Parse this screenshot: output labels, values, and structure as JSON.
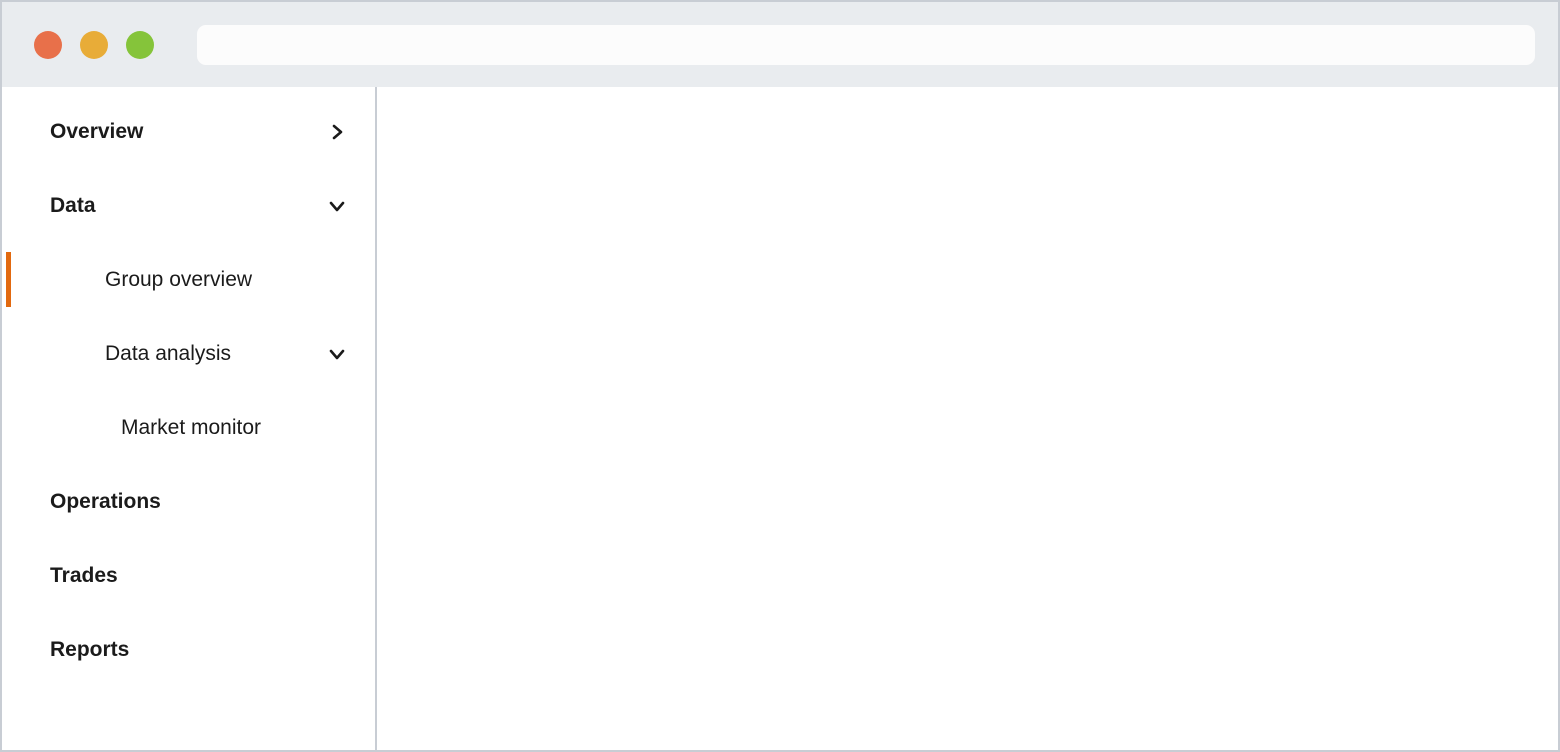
{
  "window": {
    "traffic_lights": [
      {
        "name": "close",
        "color": "#e8704a"
      },
      {
        "name": "minimize",
        "color": "#e8ac38"
      },
      {
        "name": "maximize",
        "color": "#85c43a"
      }
    ]
  },
  "address_bar": {
    "value": "",
    "placeholder": ""
  },
  "theme": {
    "chrome_background": "#e9ecef",
    "window_border": "#c8cdd4",
    "accent": "#e2690f",
    "text": "#1b1b1b",
    "panel_background": "#ffffff"
  },
  "sidebar": {
    "items": [
      {
        "label": "Overview",
        "level": 0,
        "chevron": "chevron-right-icon",
        "active": false
      },
      {
        "label": "Data",
        "level": 0,
        "chevron": "chevron-down-icon",
        "active": false
      },
      {
        "label": "Group overview",
        "level": 1,
        "chevron": "",
        "active": true
      },
      {
        "label": "Data analysis",
        "level": 1,
        "chevron": "chevron-down-icon",
        "active": false
      },
      {
        "label": "Market monitor",
        "level": 2,
        "chevron": "",
        "active": false
      },
      {
        "label": "Operations",
        "level": 0,
        "chevron": "",
        "active": false
      },
      {
        "label": "Trades",
        "level": 0,
        "chevron": "",
        "active": false
      },
      {
        "label": "Reports",
        "level": 0,
        "chevron": "",
        "active": false
      }
    ]
  },
  "content": {
    "body_text": ""
  }
}
